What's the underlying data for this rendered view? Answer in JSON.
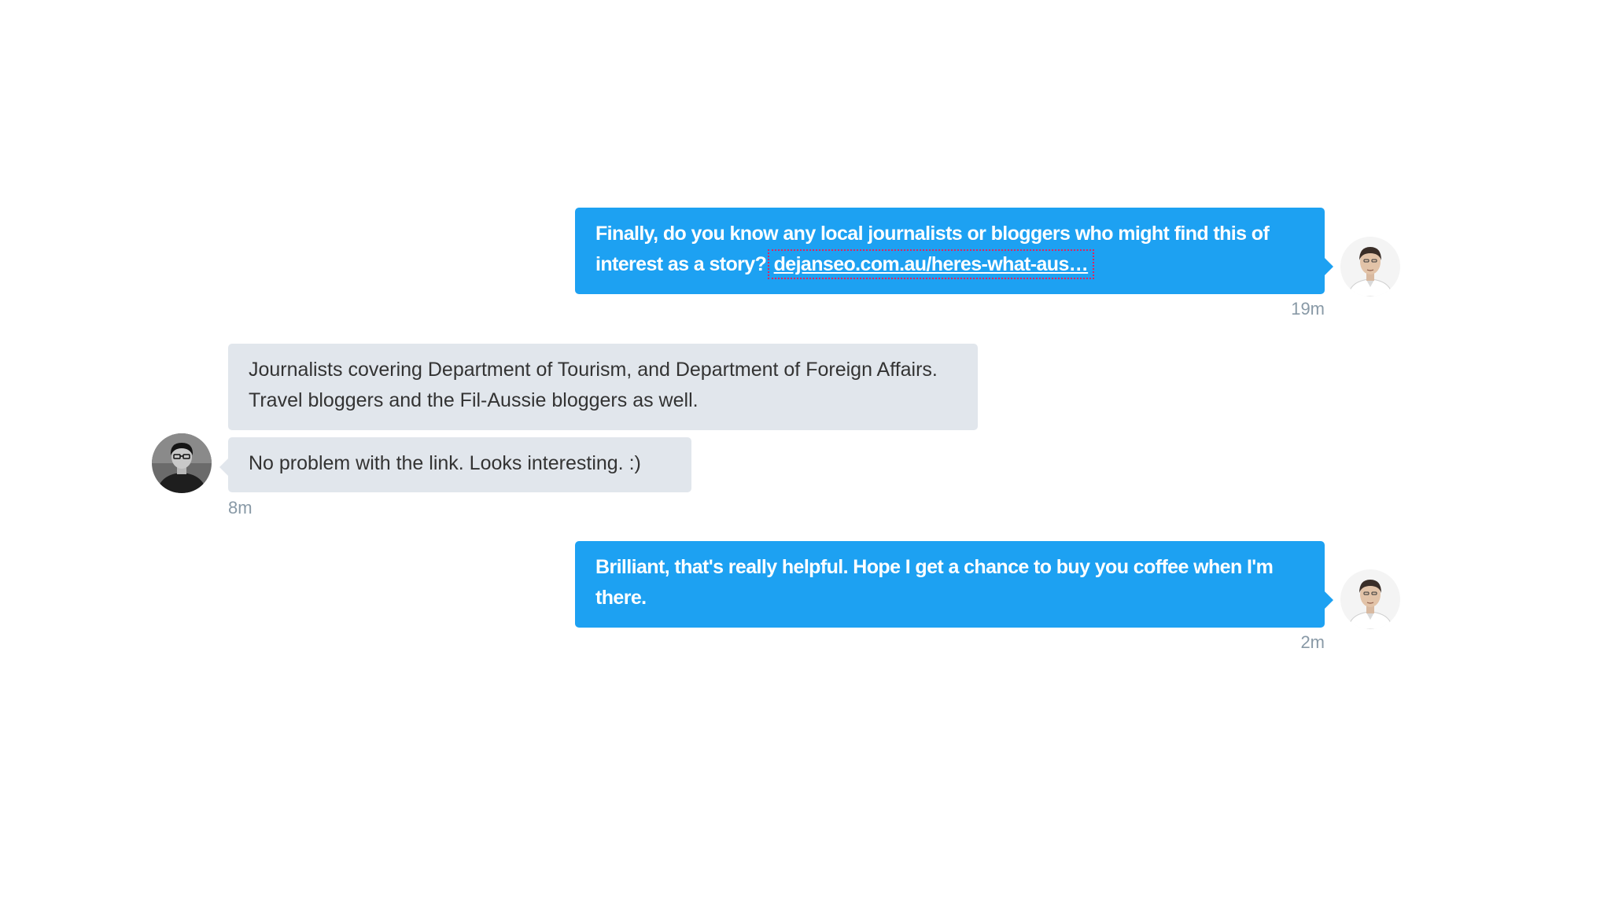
{
  "conversation": {
    "messages": [
      {
        "direction": "outgoing",
        "text": "Finally, do you know any local journalists or bloggers who might find this of interest as a story? ",
        "link_text": "dejanseo.com.au/heres-what-aus…",
        "time": "19m"
      },
      {
        "direction": "incoming",
        "text": "Journalists covering Department of Tourism, and Department of Foreign Affairs. Travel bloggers and the Fil-Aussie bloggers as well."
      },
      {
        "direction": "incoming",
        "text": "No problem with the link. Looks interesting. :)",
        "time": "8m"
      },
      {
        "direction": "outgoing",
        "text": "Brilliant, that's really helpful. Hope I get a chance to buy you coffee when I'm there.",
        "time": "2m"
      }
    ]
  },
  "colors": {
    "outgoing_bubble": "#1da1f2",
    "incoming_bubble": "#e1e6ec",
    "timestamp": "#8899a6"
  },
  "icons": {
    "sender_avatar": "user-avatar-icon",
    "recipient_avatar": "contact-avatar-icon"
  }
}
